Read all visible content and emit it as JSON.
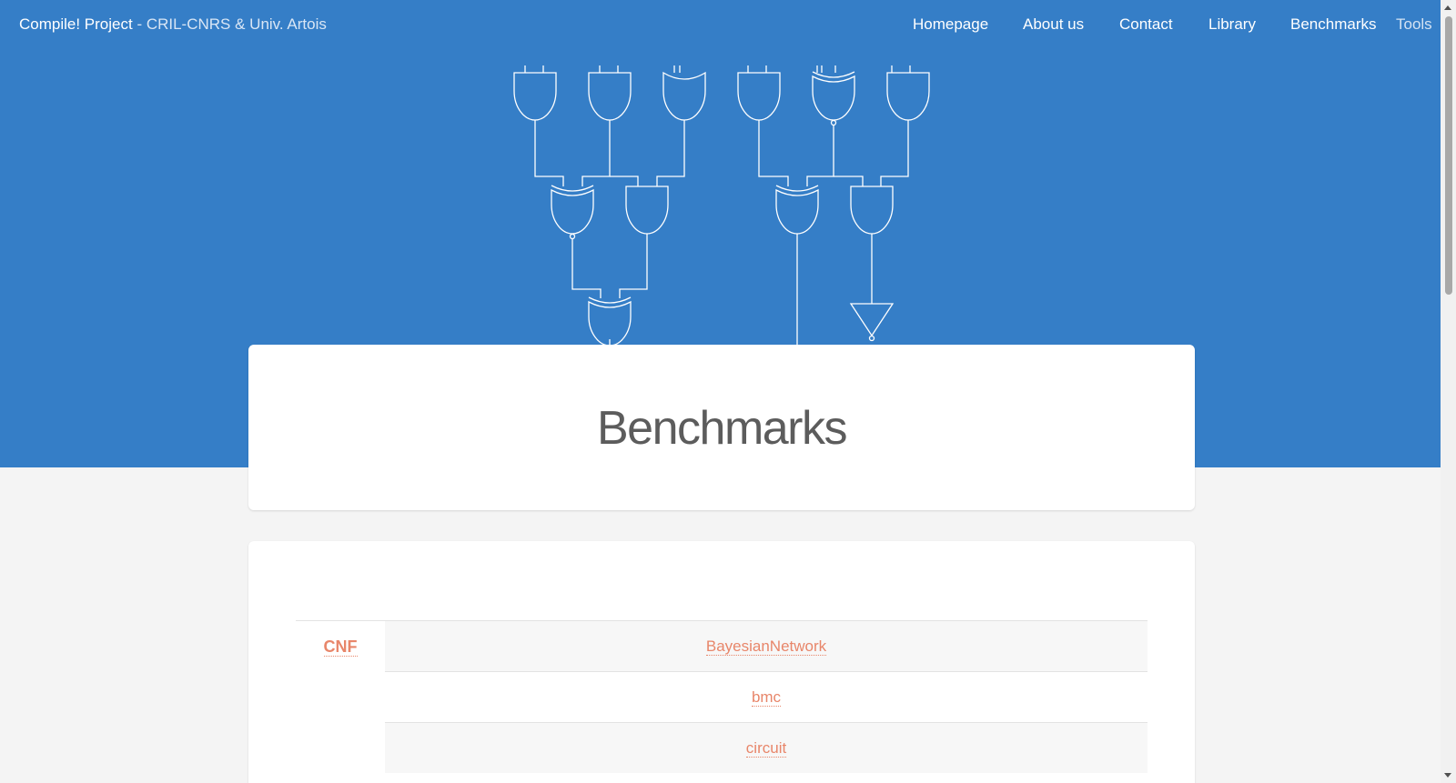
{
  "header": {
    "brand": "Compile! Project",
    "brand_separator": " - ",
    "brand_sub": "CRIL-CNRS & Univ. Artois",
    "nav": [
      {
        "label": "Homepage"
      },
      {
        "label": "About us"
      },
      {
        "label": "Contact"
      },
      {
        "label": "Library"
      },
      {
        "label": "Benchmarks"
      },
      {
        "label": "Tools"
      }
    ]
  },
  "hero": {
    "illustration": "logic-circuit-gates"
  },
  "main": {
    "title": "Benchmarks",
    "groups": [
      {
        "label": "CNF",
        "items": [
          "BayesianNetwork",
          "bmc",
          "circuit"
        ]
      }
    ]
  },
  "colors": {
    "hero_bg": "#357ec7",
    "accent": "#e8866a",
    "page_bg": "#f4f4f4"
  }
}
